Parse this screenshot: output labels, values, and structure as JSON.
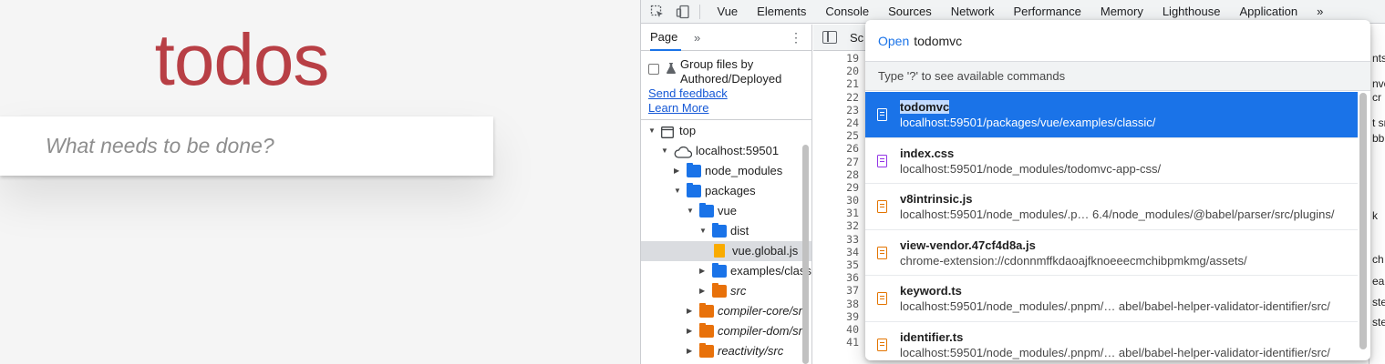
{
  "todo": {
    "title": "todos",
    "input_placeholder": "What needs to be done?"
  },
  "devtools": {
    "main_tabs": [
      "Vue",
      "Elements",
      "Console",
      "Sources",
      "Network",
      "Performance",
      "Memory",
      "Lighthouse",
      "Application"
    ],
    "active_tab": "Sources",
    "overflow": "»",
    "navigator": {
      "tab": "Page",
      "more": "»",
      "group_label": "Group files by Authored/Deployed",
      "send_feedback": "Send feedback",
      "learn_more": "Learn More",
      "tree": [
        {
          "label": "top",
          "icon": "frame-icon",
          "arrow": "▼",
          "level": 0
        },
        {
          "label": "localhost:59501",
          "icon": "cloud-icon",
          "arrow": "▼",
          "level": 1
        },
        {
          "label": "node_modules",
          "icon": "folder-icon",
          "arrow": "▶",
          "level": 2
        },
        {
          "label": "packages",
          "icon": "folder-icon",
          "arrow": "▼",
          "level": 2
        },
        {
          "label": "vue",
          "icon": "folder-icon",
          "arrow": "▼",
          "level": 3
        },
        {
          "label": "dist",
          "icon": "folder-icon",
          "arrow": "▼",
          "level": 4
        },
        {
          "label": "vue.global.js",
          "icon": "file-icon",
          "arrow": "",
          "level": 5,
          "selected": true
        },
        {
          "label": "examples/classic",
          "icon": "folder-icon",
          "arrow": "▶",
          "level": 4
        },
        {
          "label": "src",
          "icon": "folder-orange-icon",
          "arrow": "▶",
          "level": 4,
          "italic": true
        },
        {
          "label": "compiler-core/src",
          "icon": "folder-orange-icon",
          "arrow": "▶",
          "level": 3,
          "italic": true
        },
        {
          "label": "compiler-dom/src",
          "icon": "folder-orange-icon",
          "arrow": "▶",
          "level": 3,
          "italic": true
        },
        {
          "label": "reactivity/src",
          "icon": "folder-orange-icon",
          "arrow": "▶",
          "level": 3,
          "italic": true
        }
      ]
    },
    "editor": {
      "tab_label": "Sc",
      "line_numbers": [
        "19",
        "20",
        "21",
        "22",
        "23",
        "24",
        "25",
        "26",
        "27",
        "28",
        "29",
        "30",
        "31",
        "32",
        "33",
        "34",
        "35",
        "36",
        "37",
        "38",
        "39",
        "40",
        "41"
      ]
    },
    "right_partial": [
      "nts",
      "nvc",
      "cr",
      "t sr",
      "bb",
      "k",
      "ch B",
      "eak",
      "ste",
      "ster"
    ]
  },
  "palette": {
    "prefix": "Open",
    "query": "todomvc",
    "hint": "Type '?' to see available commands",
    "items": [
      {
        "title": "todomvc",
        "path": "localhost:59501/packages/vue/examples/classic/",
        "icon": "document-icon",
        "selected": true
      },
      {
        "title": "index.css",
        "path": "localhost:59501/node_modules/todomvc-app-css/",
        "icon": "css-file-icon"
      },
      {
        "title": "v8intrinsic.js",
        "path": "localhost:59501/node_modules/.p… 6.4/node_modules/@babel/parser/src/plugins/",
        "icon": "js-file-icon"
      },
      {
        "title": "view-vendor.47cf4d8a.js",
        "path": "chrome-extension://cdonnmffkdaoajfknoeeecmchibpmkmg/assets/",
        "icon": "js-file-icon"
      },
      {
        "title": "keyword.ts",
        "path": "localhost:59501/node_modules/.pnpm/…  abel/babel-helper-validator-identifier/src/",
        "icon": "js-file-icon"
      },
      {
        "title": "identifier.ts",
        "path": "localhost:59501/node_modules/.pnpm/…  abel/babel-helper-validator-identifier/src/",
        "icon": "js-file-icon"
      }
    ]
  }
}
